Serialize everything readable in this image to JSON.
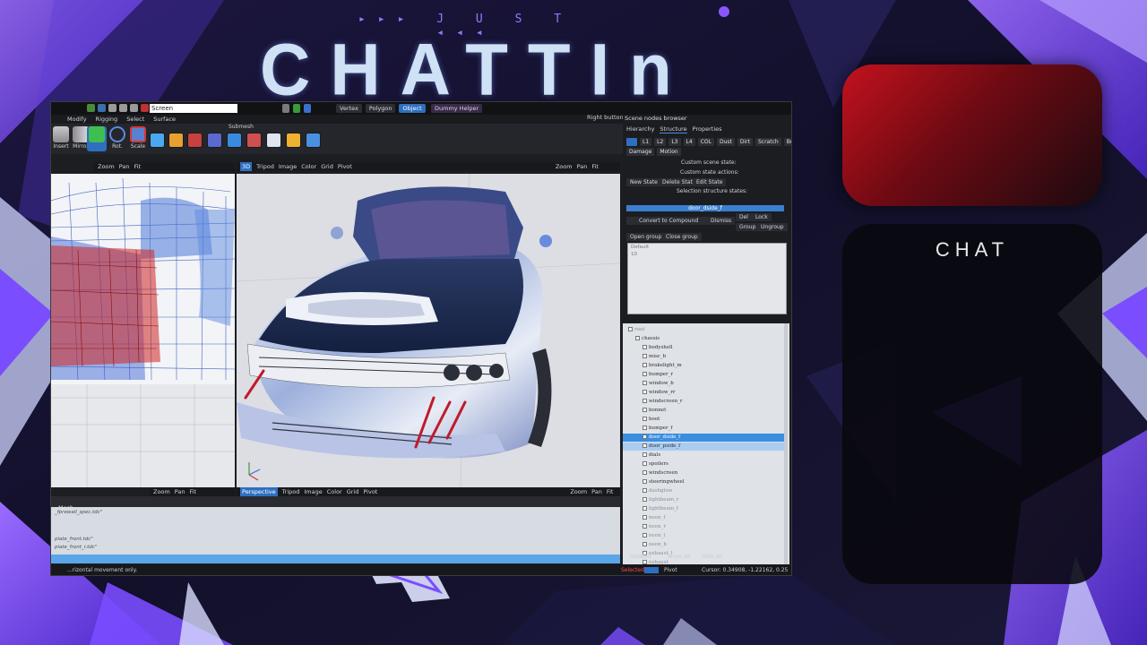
{
  "overlay": {
    "subtitle": "▸▸▸ J U S T ◂◂◂",
    "title": "CHATTIn",
    "chat_label": "CHAT",
    "colors": {
      "purple": "#7a4dff",
      "red": "#c4121e",
      "dark": "#14112b"
    }
  },
  "editor": {
    "screen_field": "Screen",
    "modes": [
      "Vertex",
      "Polygon",
      "Object"
    ],
    "active_mode": "Object",
    "dummy_helper": "Dummy Helper",
    "right_button": "Right button",
    "menu": [
      "Modify",
      "Rigging",
      "Select",
      "Surface"
    ],
    "ribbon": {
      "tools": [
        "Insert",
        "Mirror",
        "Rot.",
        "Scale"
      ],
      "submesh": "Submesh"
    },
    "left_toolbar": [
      "Zoom",
      "Pan",
      "Fit"
    ],
    "main_toolbar": [
      "3D",
      "Tripod",
      "Image",
      "Color",
      "Grid",
      "Pivot",
      "Zoom",
      "Pan",
      "Fit"
    ],
    "bottom_toolbar_left": [
      "Zoom",
      "Pan",
      "Fit"
    ],
    "bottom_toolbar_main": [
      "Perspective",
      "Tripod",
      "Image",
      "Color",
      "Grid",
      "Pivot"
    ],
    "bottom_toolbar_right": [
      "Zoom",
      "Pan",
      "Fit"
    ],
    "console_tab": "Mesh",
    "console_lines": [
      "_fprewall_spec.tdc\"",
      "plate_front.tdc\"",
      "plate_front_r.tdc\""
    ],
    "status": {
      "hint": "...rizontal movement only.",
      "selected": "Selected",
      "pivot": "Pivot",
      "cursor": "Cursor: 0.34908, -1.22162, 0.25"
    }
  },
  "panel": {
    "title": "Scene nodes browser",
    "tabs": [
      "Hierarchy",
      "Structure",
      "Properties"
    ],
    "state_buttons": [
      "",
      "L1",
      "L2",
      "L3",
      "L4",
      "COL",
      "Dust",
      "Dirt",
      "Scratch",
      "Burn"
    ],
    "state_buttons_2": [
      "Damage",
      "Motion"
    ],
    "custom_scene_state": "Custom scene state:",
    "custom_state_actions": "Custom state actions:",
    "new_state": "New State",
    "delete_state": "Delete State",
    "edit_state": "Edit State",
    "selection_states": "Selection structure states:",
    "selected_node": "door_dside_f",
    "convert": "Convert to Compound",
    "dismiss": "Dismiss",
    "del": "Del",
    "lock": "Lock",
    "group": "Group",
    "ungroup": "Ungroup",
    "open_group": "Open group",
    "close_group": "Close group",
    "default_box": [
      "Default",
      "10"
    ],
    "isolated": "Isolated",
    "show_all": "Show All",
    "hide_all": "Hide All"
  },
  "tree": {
    "items": [
      {
        "label": "root",
        "indent": 0,
        "style": "dim"
      },
      {
        "label": "chassis",
        "indent": 1,
        "style": ""
      },
      {
        "label": "bodyshell",
        "indent": 2,
        "style": ""
      },
      {
        "label": "misc_b",
        "indent": 2,
        "style": ""
      },
      {
        "label": "brakelight_m",
        "indent": 2,
        "style": ""
      },
      {
        "label": "bumper_r",
        "indent": 2,
        "style": ""
      },
      {
        "label": "window_b",
        "indent": 2,
        "style": ""
      },
      {
        "label": "window_rr",
        "indent": 2,
        "style": ""
      },
      {
        "label": "windscreen_r",
        "indent": 2,
        "style": ""
      },
      {
        "label": "bonnet",
        "indent": 2,
        "style": ""
      },
      {
        "label": "boot",
        "indent": 2,
        "style": ""
      },
      {
        "label": "bumper_f",
        "indent": 2,
        "style": ""
      },
      {
        "label": "door_dside_f",
        "indent": 2,
        "style": "sel"
      },
      {
        "label": "door_pside_f",
        "indent": 2,
        "style": "sel2"
      },
      {
        "label": "dials",
        "indent": 2,
        "style": ""
      },
      {
        "label": "spoilers",
        "indent": 2,
        "style": ""
      },
      {
        "label": "windscreen",
        "indent": 2,
        "style": ""
      },
      {
        "label": "steeringwheel",
        "indent": 2,
        "style": ""
      },
      {
        "label": "dashglow",
        "indent": 2,
        "style": "dim"
      },
      {
        "label": "lightbeam_r",
        "indent": 2,
        "style": "dim"
      },
      {
        "label": "lightbeam_f",
        "indent": 2,
        "style": "dim"
      },
      {
        "label": "neon_f",
        "indent": 2,
        "style": "dim"
      },
      {
        "label": "neon_r",
        "indent": 2,
        "style": "dim"
      },
      {
        "label": "neon_l",
        "indent": 2,
        "style": "dim"
      },
      {
        "label": "neon_b",
        "indent": 2,
        "style": "dim"
      },
      {
        "label": "exhaust_l",
        "indent": 2,
        "style": "dim"
      },
      {
        "label": "exhaust",
        "indent": 2,
        "style": "dim"
      }
    ]
  }
}
